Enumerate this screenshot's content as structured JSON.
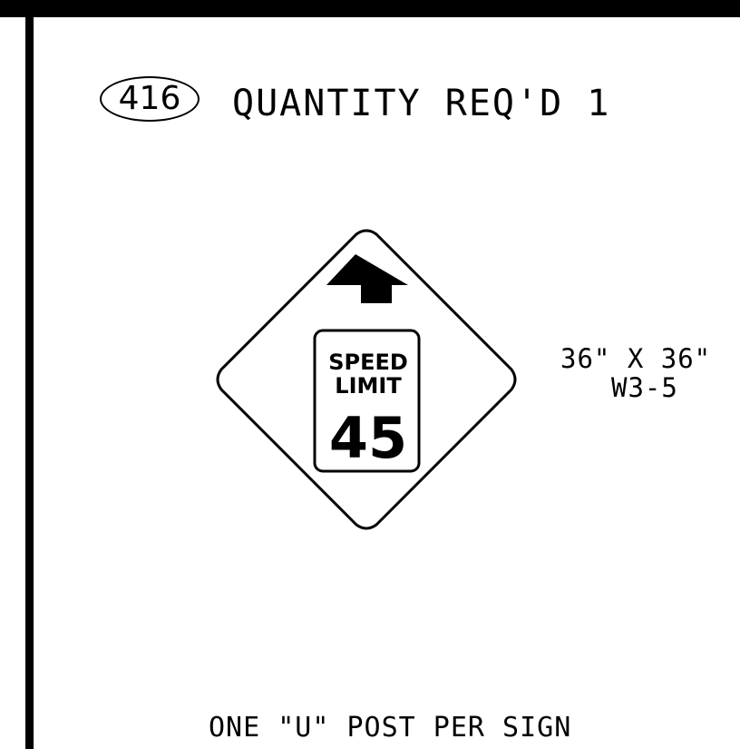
{
  "sign_number": "416",
  "quantity_label": "QUANTITY REQ'D 1",
  "sign": {
    "speed_text": "SPEED",
    "limit_text": "LIMIT",
    "speed_value": "45"
  },
  "dimensions": "36\" X 36\"",
  "sign_code": "W3-5",
  "footer_note": "ONE \"U\" POST PER SIGN"
}
